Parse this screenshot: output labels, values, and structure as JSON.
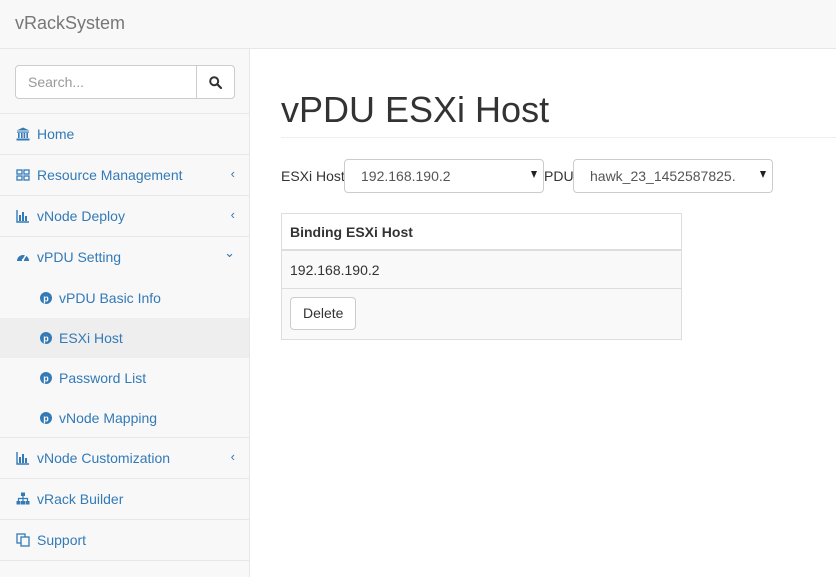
{
  "app": {
    "brand": "vRackSystem"
  },
  "search": {
    "placeholder": "Search...",
    "icon": "search-icon"
  },
  "sidebar": {
    "items": [
      {
        "label": "Home",
        "icon": "bank-icon"
      },
      {
        "label": "Resource Management",
        "icon": "barcode-icon",
        "arrow": "‹"
      },
      {
        "label": "vNode Deploy",
        "icon": "bar-chart-icon",
        "arrow": "‹"
      },
      {
        "label": "vPDU Setting",
        "icon": "dashboard-icon",
        "arrow": "⌄"
      },
      {
        "label": "vNode Customization",
        "icon": "bar-chart-icon",
        "arrow": "‹"
      },
      {
        "label": "vRack Builder",
        "icon": "sitemap-icon"
      },
      {
        "label": "Support",
        "icon": "copy-icon"
      }
    ],
    "subitems": [
      {
        "label": "vPDU Basic Info",
        "icon": "pinterest-icon"
      },
      {
        "label": "ESXi Host",
        "icon": "pinterest-icon",
        "active": true
      },
      {
        "label": "Password List",
        "icon": "pinterest-icon"
      },
      {
        "label": "vNode Mapping",
        "icon": "pinterest-icon"
      }
    ]
  },
  "main": {
    "title": "vPDU ESXi Host",
    "esxi_label": "ESXi Host",
    "esxi_selected": "192.168.190.2",
    "pdu_label": "PDU",
    "pdu_selected": "hawk_23_1452587825.",
    "table": {
      "header": "Binding ESXi Host",
      "rows": [
        "192.168.190.2"
      ],
      "delete_label": "Delete"
    }
  },
  "colors": {
    "link": "#337ab7",
    "sidebar_bg": "#f8f8f8",
    "active_bg": "#eeeeee"
  }
}
